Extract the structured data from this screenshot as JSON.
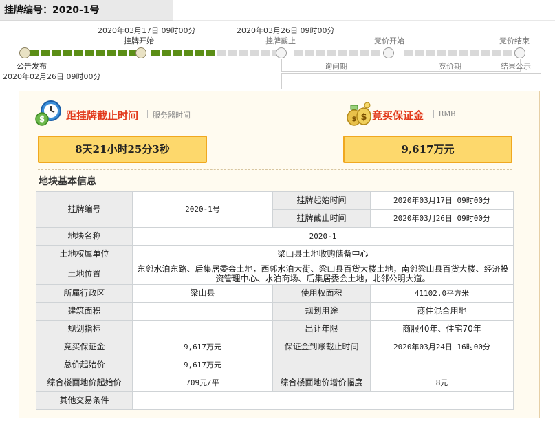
{
  "header": {
    "title": "挂牌编号：2020-1号"
  },
  "timeline": {
    "publish": {
      "label": "公告发布",
      "date": "2020年02月26日 09时00分"
    },
    "start": {
      "label": "挂牌开始",
      "date": "2020年03月17日 09时00分"
    },
    "end": {
      "label": "挂牌截止",
      "date": "2020年03月26日 09时00分"
    },
    "bid_start": {
      "label": "竞价开始"
    },
    "bid_end": {
      "label": "竞价结束"
    },
    "inquiry_period": "询问期",
    "bid_period": "竞价期",
    "result": "结果公示"
  },
  "countdown": {
    "title": "距挂牌截止时间",
    "subtitle": "服务器时间",
    "value": "8天21小时25分3秒"
  },
  "deposit": {
    "title": "竞买保证金",
    "subtitle": "RMB",
    "value": "9,617万元"
  },
  "section_title": "地块基本信息",
  "table": {
    "listing_no_label": "挂牌编号",
    "listing_no": "2020-1号",
    "listing_start_label": "挂牌起始时间",
    "listing_start": "2020年03月17日 09时00分",
    "listing_end_label": "挂牌截止时间",
    "listing_end": "2020年03月26日 09时00分",
    "parcel_name_label": "地块名称",
    "parcel_name": "2020-1",
    "owner_label": "土地权属单位",
    "owner": "梁山县土地收购储备中心",
    "location_label": "土地位置",
    "location": "东邻水泊东路、后集居委会土地，西邻水泊大街、梁山县百货大楼土地，南邻梁山县百货大楼、经济投资管理中心、水泊商场、后集居委会土地，北邻公明大道。",
    "district_label": "所属行政区",
    "district": "梁山县",
    "use_area_label": "使用权面积",
    "use_area": "41102.0平方米",
    "building_area_label": "建筑面积",
    "building_area": "",
    "planned_use_label": "规划用途",
    "planned_use": "商住混合用地",
    "plan_index_label": "规划指标",
    "plan_index": "",
    "term_label": "出让年限",
    "term": "商服40年、住宅70年",
    "deposit_label": "竞买保证金",
    "deposit": "9,617万元",
    "deposit_deadline_label": "保证金到账截止时间",
    "deposit_deadline": "2020年03月24日 16时00分",
    "total_start_label": "总价起始价",
    "total_start": "9,617万元",
    "floor_price_label": "综合楼面地价起始价",
    "floor_price": "709元/平",
    "floor_increment_label": "综合楼面地价增价幅度",
    "floor_increment": "8元",
    "other_label": "其他交易条件",
    "other": ""
  },
  "colors": {
    "progress_done": "#5b8e16",
    "progress_todo": "#d9d9d9",
    "accent_red": "#e23a1c",
    "value_box_fill": "#fdd86c",
    "value_box_border": "#f0a820"
  },
  "icons": {
    "countdown": "clock-money-icon",
    "deposit": "money-bags-icon"
  }
}
